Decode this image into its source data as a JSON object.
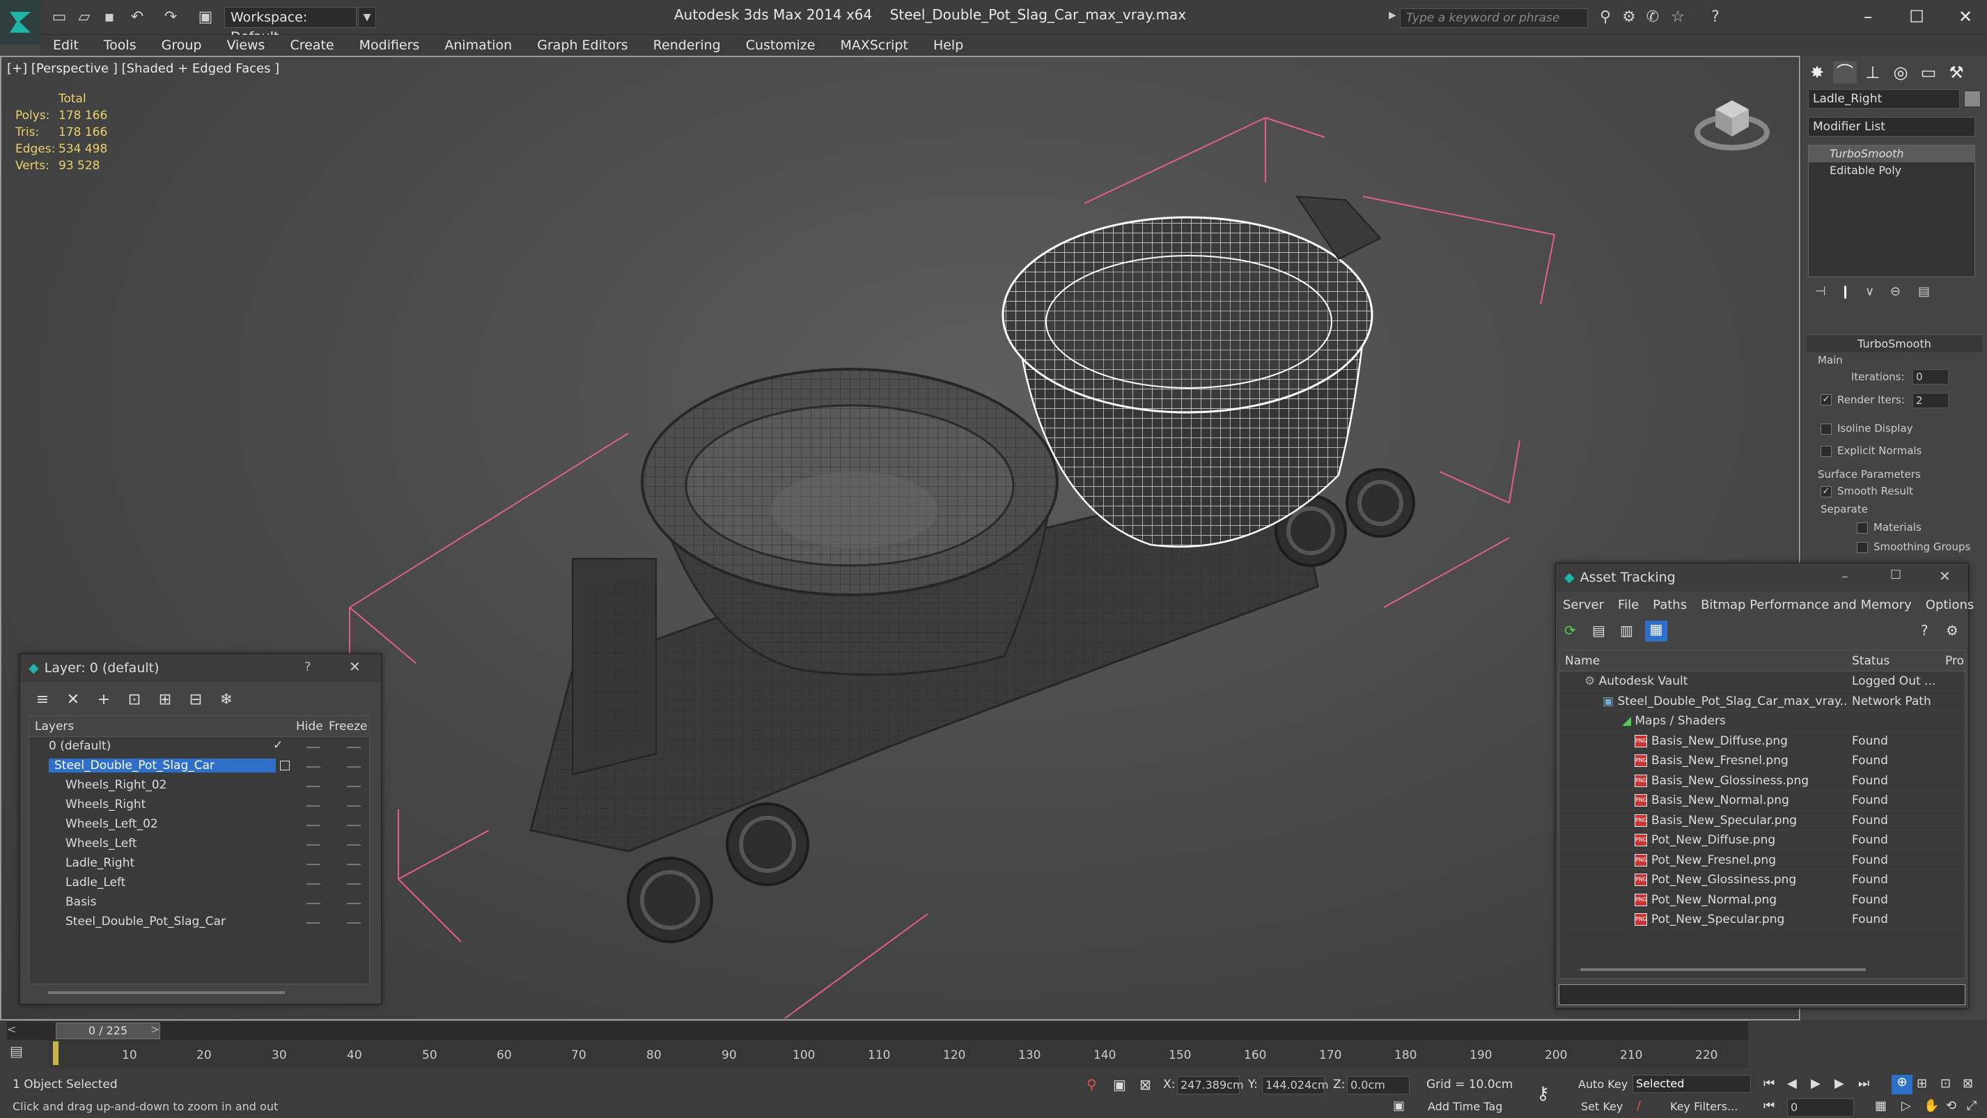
{
  "app": {
    "title": "Autodesk 3ds Max  2014 x64",
    "file": "Steel_Double_Pot_Slag_Car_max_vray.max",
    "workspace": "Workspace: Default",
    "search_placeholder": "Type a keyword or phrase"
  },
  "menu": [
    "Edit",
    "Tools",
    "Group",
    "Views",
    "Create",
    "Modifiers",
    "Animation",
    "Graph Editors",
    "Rendering",
    "Customize",
    "MAXScript",
    "Help"
  ],
  "viewport": {
    "label": "[+] [Perspective ] [Shaded + Edged Faces ]",
    "stats": {
      "header": "Total",
      "polys_label": "Polys:",
      "polys": "178 166",
      "tris_label": "Tris:",
      "tris": "178 166",
      "edges_label": "Edges:",
      "edges": "534 498",
      "verts_label": "Verts:",
      "verts": "93 528"
    }
  },
  "command_panel": {
    "object_name": "Ladle_Right",
    "modifier_list": "Modifier List",
    "stack": [
      "TurboSmooth",
      "Editable Poly"
    ],
    "rollout_title": "TurboSmooth",
    "main_label": "Main",
    "iterations_label": "Iterations:",
    "iterations": "0",
    "render_iters_label": "Render Iters:",
    "render_iters": "2",
    "isoline": "Isoline Display",
    "explicit_normals": "Explicit Normals",
    "surface_params": "Surface Parameters",
    "smooth_result": "Smooth Result",
    "separate": "Separate",
    "materials": "Materials",
    "smoothing_groups": "Smoothing Groups"
  },
  "layer_window": {
    "title": "Layer: 0 (default)",
    "help": "?",
    "close": "✕",
    "col_layers": "Layers",
    "col_hide": "Hide",
    "col_freeze": "Freeze",
    "rows": [
      {
        "name": "0 (default)"
      },
      {
        "name": "Steel_Double_Pot_Slag_Car"
      },
      {
        "name": "Wheels_Right_02"
      },
      {
        "name": "Wheels_Right"
      },
      {
        "name": "Wheels_Left_02"
      },
      {
        "name": "Wheels_Left"
      },
      {
        "name": "Ladle_Right"
      },
      {
        "name": "Ladle_Left"
      },
      {
        "name": "Basis"
      },
      {
        "name": "Steel_Double_Pot_Slag_Car"
      }
    ]
  },
  "asset_tracking": {
    "title": "Asset Tracking",
    "menu": [
      "Server",
      "File",
      "Paths",
      "Bitmap Performance and Memory",
      "Options"
    ],
    "col_name": "Name",
    "col_status": "Status",
    "col_pro": "Pro",
    "rows": [
      {
        "name": "Autodesk Vault",
        "status": "Logged Out ..."
      },
      {
        "name": "Steel_Double_Pot_Slag_Car_max_vray....",
        "status": "Network Path"
      },
      {
        "name": "Maps / Shaders",
        "status": ""
      },
      {
        "name": "Basis_New_Diffuse.png",
        "status": "Found"
      },
      {
        "name": "Basis_New_Fresnel.png",
        "status": "Found"
      },
      {
        "name": "Basis_New_Glossiness.png",
        "status": "Found"
      },
      {
        "name": "Basis_New_Normal.png",
        "status": "Found"
      },
      {
        "name": "Basis_New_Specular.png",
        "status": "Found"
      },
      {
        "name": "Pot_New_Diffuse.png",
        "status": "Found"
      },
      {
        "name": "Pot_New_Fresnel.png",
        "status": "Found"
      },
      {
        "name": "Pot_New_Glossiness.png",
        "status": "Found"
      },
      {
        "name": "Pot_New_Normal.png",
        "status": "Found"
      },
      {
        "name": "Pot_New_Specular.png",
        "status": "Found"
      }
    ]
  },
  "timeline": {
    "frame": "0 / 225",
    "ticks": [
      "10",
      "20",
      "30",
      "40",
      "50",
      "60",
      "70",
      "80",
      "90",
      "100",
      "110",
      "120",
      "130",
      "140",
      "150",
      "160",
      "170",
      "180",
      "190",
      "200",
      "210",
      "220"
    ]
  },
  "status_bar": {
    "selection": "1 Object Selected",
    "prompt": "Click and drag up-and-down to zoom in and out",
    "x_label": "X:",
    "x": "247.389cm",
    "y_label": "Y:",
    "y": "144.024cm",
    "z_label": "Z:",
    "z": "0.0cm",
    "grid": "Grid = 10.0cm",
    "auto_key": "Auto Key",
    "set_key": "Set Key",
    "selected": "Selected",
    "key_filters": "Key Filters...",
    "add_time_tag": "Add Time Tag",
    "frame_field": "0"
  },
  "colors": {
    "selection_blue": "#2e6fc9",
    "stats_yellow": "#e8d36a",
    "bbox_pink": "#e0608a"
  }
}
